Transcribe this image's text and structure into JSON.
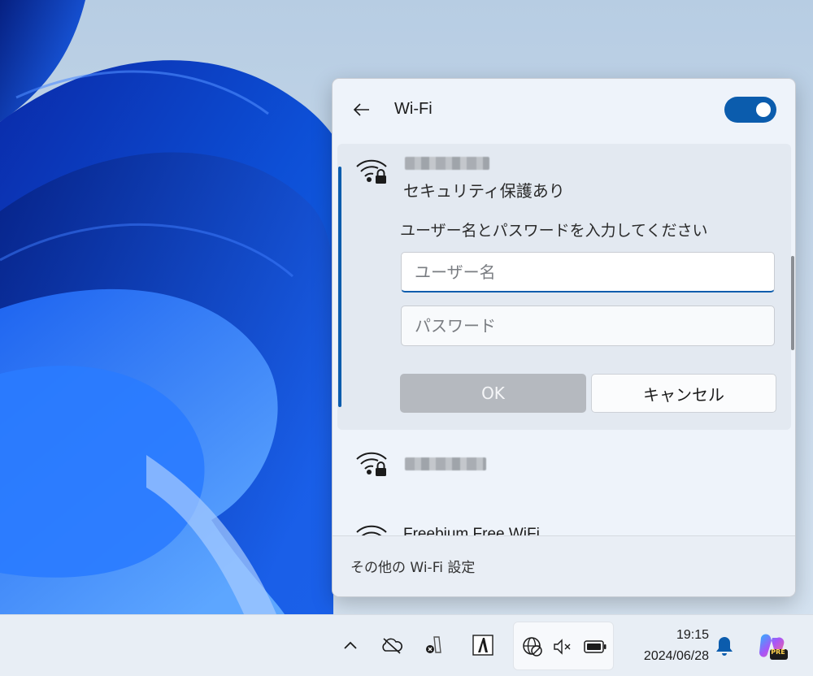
{
  "wifi_panel": {
    "title": "Wi-Fi",
    "toggle_on": true,
    "connecting_network": {
      "ssid": "",
      "status": "セキュリティ保護あり",
      "prompt": "ユーザー名とパスワードを入力してください",
      "username_placeholder": "ユーザー名",
      "password_placeholder": "パスワード",
      "ok_label": "OK",
      "cancel_label": "キャンセル"
    },
    "other_networks": [
      {
        "ssid": "",
        "secured": true
      },
      {
        "ssid": "Freebium Free WiFi",
        "secured": false
      }
    ],
    "footer_link": "その他の Wi-Fi 設定"
  },
  "taskbar": {
    "clock_time": "19:15",
    "clock_date": "2024/06/28",
    "tray_icons": [
      "chevron-up-icon",
      "onedrive-offline-icon",
      "app-error-icon",
      "font-app-icon",
      "network-disconnected-icon",
      "volume-muted-icon",
      "battery-icon",
      "notification-bell-icon",
      "copilot-pre-icon"
    ],
    "copilot_badge": "PRE"
  },
  "colors": {
    "accent": "#0b5cad",
    "panel_bg": "#eef3fa",
    "taskbar_bg": "#e8eef5"
  }
}
